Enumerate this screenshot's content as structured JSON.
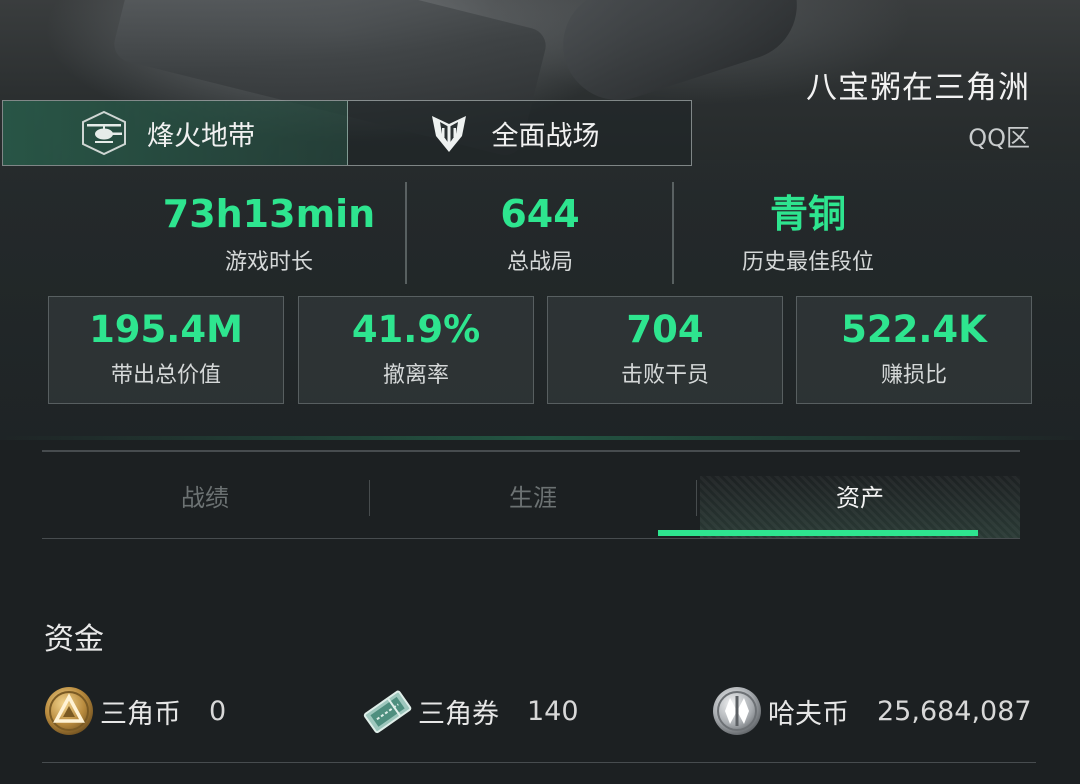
{
  "header": {
    "player_name": "八宝粥在三角洲",
    "region": "QQ区"
  },
  "mode_tabs": [
    {
      "label": "烽火地带",
      "icon": "helicopter-icon",
      "active": true
    },
    {
      "label": "全面战场",
      "icon": "shield-emblem-icon",
      "active": false
    }
  ],
  "summary": [
    {
      "value": "73h13min",
      "label": "游戏时长"
    },
    {
      "value": "644",
      "label": "总战局"
    },
    {
      "value": "青铜",
      "label": "历史最佳段位"
    }
  ],
  "cards": [
    {
      "value": "195.4M",
      "label": "带出总价值"
    },
    {
      "value": "41.9%",
      "label": "撤离率"
    },
    {
      "value": "704",
      "label": "击败干员"
    },
    {
      "value": "522.4K",
      "label": "赚损比"
    }
  ],
  "content_tabs": [
    {
      "label": "战绩",
      "active": false
    },
    {
      "label": "生涯",
      "active": false
    },
    {
      "label": "资产",
      "active": true
    }
  ],
  "funds": {
    "title": "资金",
    "items": [
      {
        "name": "三角币",
        "value": "0",
        "icon": "triangle-coin-icon"
      },
      {
        "name": "三角券",
        "value": "140",
        "icon": "voucher-ticket-icon"
      },
      {
        "name": "哈夫币",
        "value": "25,684,087",
        "icon": "haf-coin-icon"
      }
    ]
  },
  "colors": {
    "accent": "#2ee58f",
    "background": "#1c2022",
    "active_tab_bg": "#285c4a"
  }
}
